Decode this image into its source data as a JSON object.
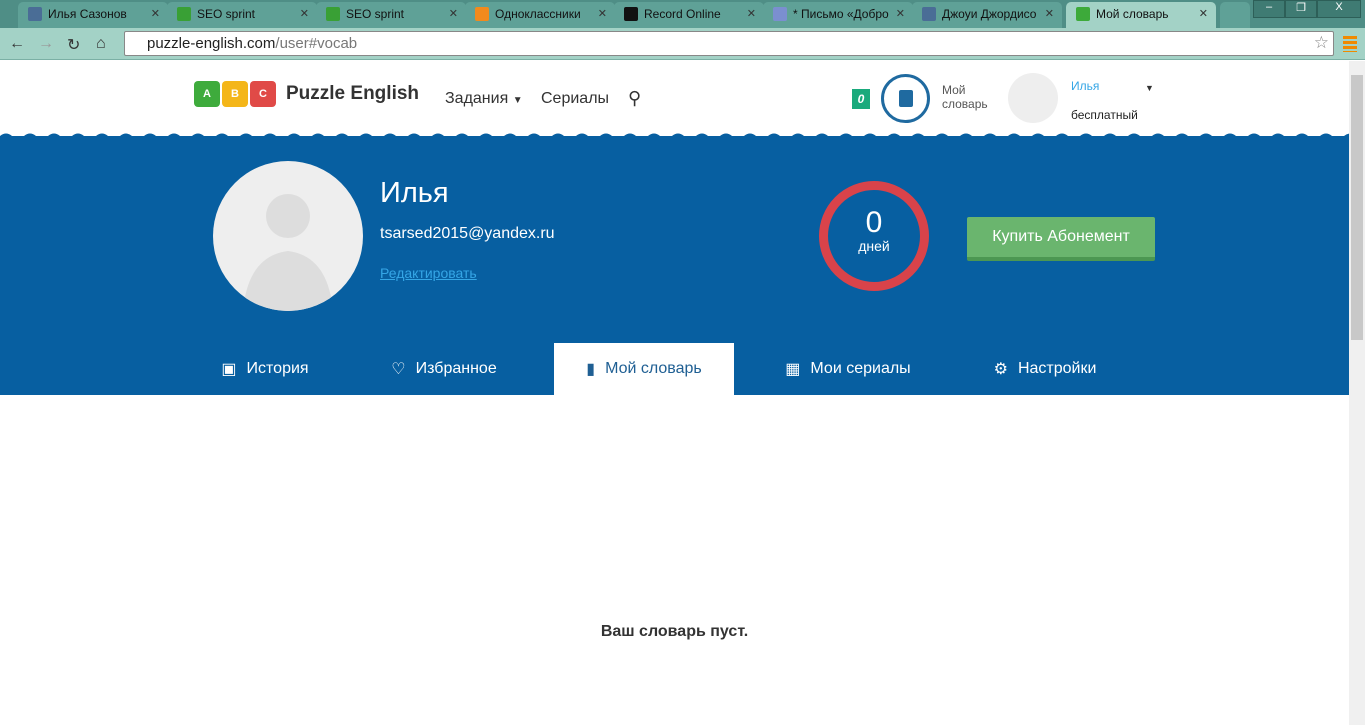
{
  "browser": {
    "tabs": [
      {
        "title": "Илья Сазонов",
        "favicon": "vk-icon",
        "color": "#4a6d96"
      },
      {
        "title": "SEO sprint",
        "favicon": "seosprint-icon",
        "color": "#39a035"
      },
      {
        "title": "SEO sprint",
        "favicon": "seosprint-icon",
        "color": "#39a035"
      },
      {
        "title": "Одноклассники",
        "favicon": "odnoklassniki-icon",
        "color": "#f28a1c"
      },
      {
        "title": "Record Online",
        "favicon": "record-icon",
        "color": "#111111"
      },
      {
        "title": "* Письмо «Добро",
        "favicon": "mail-icon",
        "color": "#7b8fd0"
      },
      {
        "title": "Джоуи Джордисо",
        "favicon": "vk-icon",
        "color": "#4a6d96"
      },
      {
        "title": "Мой словарь",
        "favicon": "puzzle-icon",
        "color": "#3daa3a"
      }
    ],
    "url_host": "puzzle-english.com",
    "url_path": "/user#vocab"
  },
  "header": {
    "logo_text": "Puzzle English",
    "logo_letters": [
      "A",
      "B",
      "C"
    ],
    "nav": {
      "tasks": "Задания",
      "series": "Сериалы"
    },
    "vocab_count": "0",
    "vocab_label_1": "Мой",
    "vocab_label_2": "словарь",
    "user_name": "Илья",
    "user_plan": "бесплатный"
  },
  "profile": {
    "name": "Илья",
    "email": "tsarsed2015@yandex.ru",
    "edit": "Редактировать",
    "days_value": "0",
    "days_label": "дней",
    "buy": "Купить Абонемент"
  },
  "tabs": [
    {
      "label": "История",
      "icon": "calendar-icon"
    },
    {
      "label": "Избранное",
      "icon": "heart-icon"
    },
    {
      "label": "Мой словарь",
      "icon": "book-icon"
    },
    {
      "label": "Мои сериалы",
      "icon": "film-icon"
    },
    {
      "label": "Настройки",
      "icon": "gear-icon"
    }
  ],
  "content": {
    "empty_message": "Ваш словарь пуст."
  }
}
